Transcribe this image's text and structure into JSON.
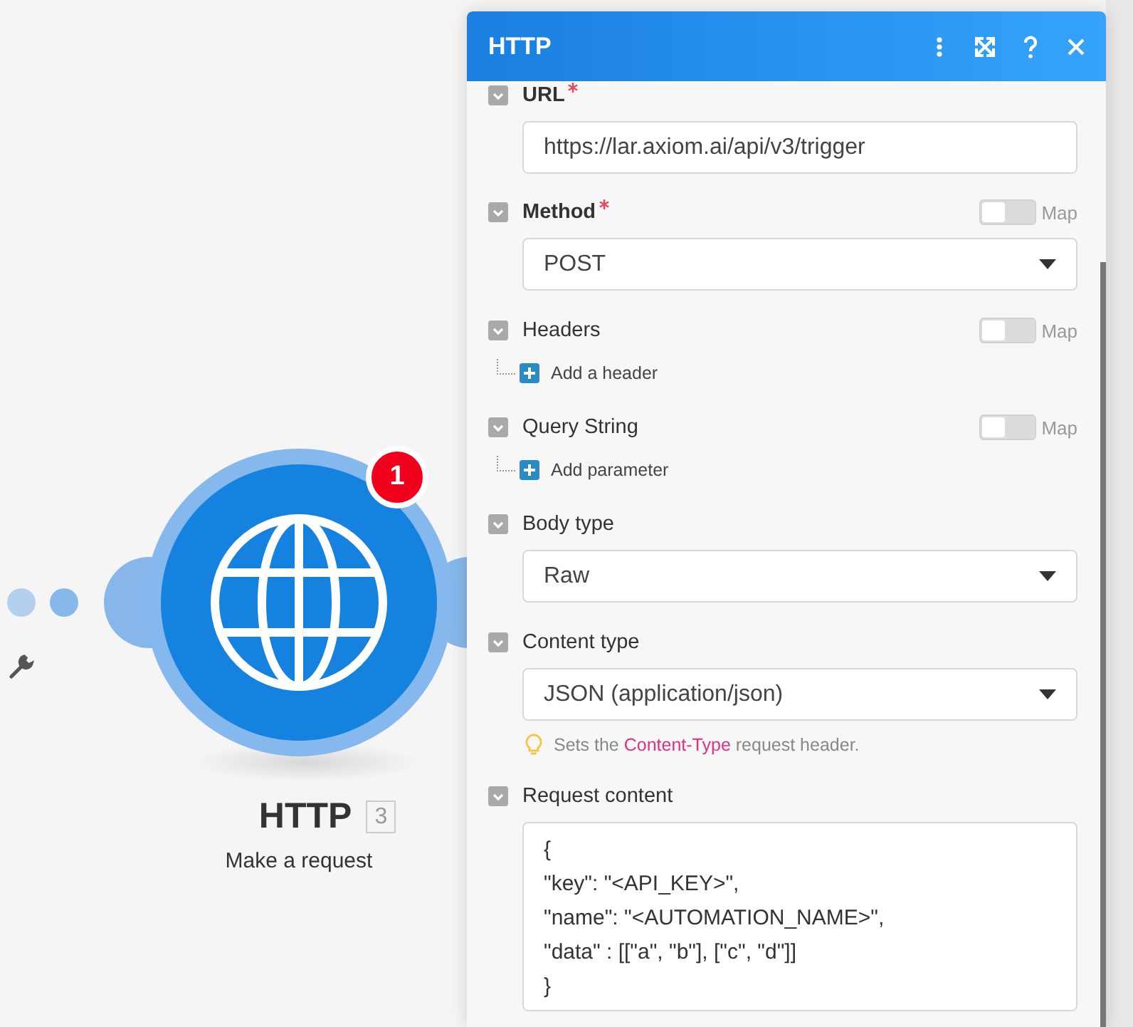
{
  "canvas": {
    "node": {
      "title": "HTTP",
      "index": "3",
      "subtitle": "Make a request",
      "notification": "1"
    }
  },
  "panel": {
    "title": "HTTP",
    "fields": [
      {
        "kind": "input",
        "label": "URL",
        "required": true,
        "expanded": true,
        "value": "https://lar.axiom.ai/api/v3/trigger"
      },
      {
        "kind": "select",
        "label": "Method",
        "required": true,
        "expanded": true,
        "map": {
          "label": "Map",
          "on": false
        },
        "value": "POST"
      },
      {
        "kind": "list",
        "label": "Headers",
        "required": false,
        "expanded": true,
        "map": {
          "label": "Map",
          "on": false
        },
        "add": "Add a header"
      },
      {
        "kind": "list",
        "label": "Query String",
        "required": false,
        "expanded": true,
        "map": {
          "label": "Map",
          "on": false
        },
        "add": "Add parameter"
      },
      {
        "kind": "select",
        "label": "Body type",
        "required": false,
        "expanded": true,
        "value": "Raw"
      },
      {
        "kind": "select",
        "label": "Content type",
        "required": false,
        "expanded": true,
        "value": "JSON (application/json)",
        "hint": {
          "before": "Sets the",
          "link": "Content-Type",
          "after": "request header."
        }
      },
      {
        "kind": "textarea",
        "label": "Request content",
        "required": false,
        "expanded": true,
        "value": "{\n\"key\": \"<API_KEY>\",\n\"name\": \"<AUTOMATION_NAME>\",\n\"data\" : [[\"a\", \"b\"], [\"c\", \"d\"]]\n}"
      }
    ]
  }
}
